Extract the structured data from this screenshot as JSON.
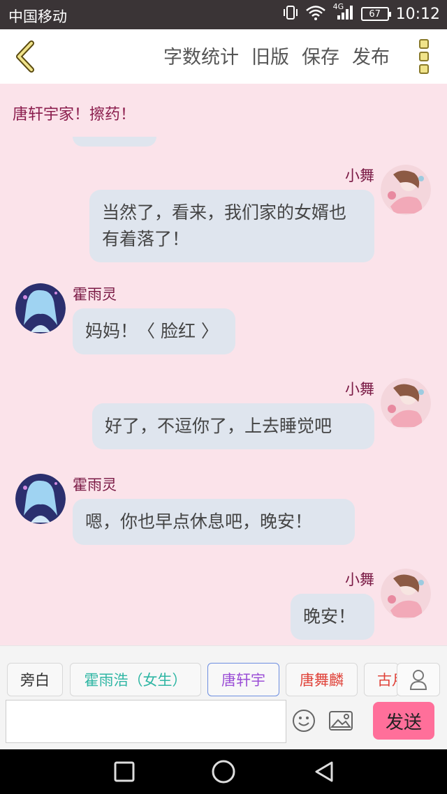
{
  "status_bar": {
    "carrier": "中国移动",
    "network": "4G",
    "battery": "67",
    "time": "10:12"
  },
  "header": {
    "actions": [
      "字数统计",
      "旧版",
      "保存",
      "发布"
    ],
    "accent_color": "#e0c84a"
  },
  "chat": {
    "scene_title": "唐轩宇家！擦药！",
    "messages": [
      {
        "speaker": "小舞",
        "side": "right",
        "text": "当然了，看来，我们家的女婿也有着落了！"
      },
      {
        "speaker": "霍雨灵",
        "side": "left",
        "text": "妈妈！〈 脸红 〉"
      },
      {
        "speaker": "小舞",
        "side": "right",
        "text": "好了，不逗你了，上去睡觉吧"
      },
      {
        "speaker": "霍雨灵",
        "side": "left",
        "text": "嗯，你也早点休息吧，晚安！"
      },
      {
        "speaker": "小舞",
        "side": "right",
        "text": "晚安！"
      }
    ],
    "name_color": "#7a1a45",
    "bubble_color": "#dfe5ee"
  },
  "roles": [
    {
      "label": "旁白",
      "color": "#333333"
    },
    {
      "label": "霍雨浩（女生）",
      "color": "#2fb6a4"
    },
    {
      "label": "唐轩宇",
      "color": "#9b4fd6"
    },
    {
      "label": "唐舞麟",
      "color": "#e0433a"
    },
    {
      "label": "古月",
      "color": "#e0433a"
    }
  ],
  "input": {
    "placeholder": "",
    "send_label": "发送",
    "send_color": "#ff6f9a"
  }
}
